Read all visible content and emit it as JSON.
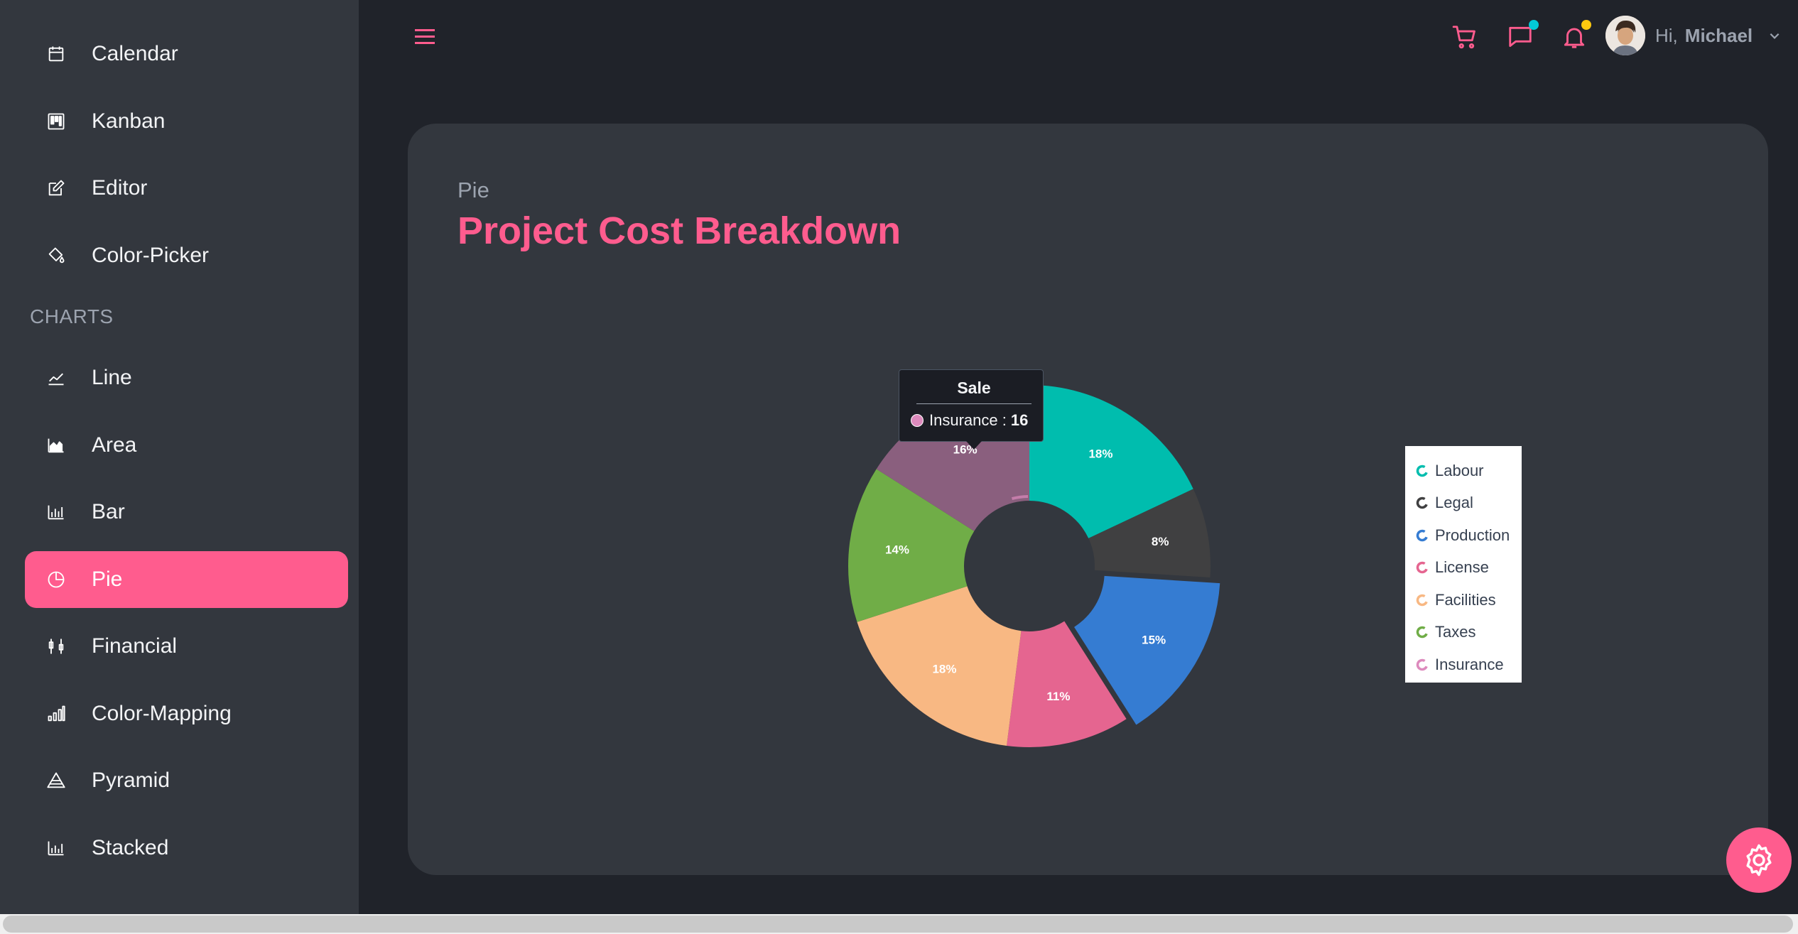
{
  "sidebar": {
    "apps_items": [
      {
        "label": "Calendar",
        "icon": "calendar-icon"
      },
      {
        "label": "Kanban",
        "icon": "kanban-icon"
      },
      {
        "label": "Editor",
        "icon": "editor-icon"
      },
      {
        "label": "Color-Picker",
        "icon": "paint-bucket-icon"
      }
    ],
    "charts_title": "CHARTS",
    "chart_items": [
      {
        "label": "Line",
        "icon": "line-chart-icon"
      },
      {
        "label": "Area",
        "icon": "area-chart-icon"
      },
      {
        "label": "Bar",
        "icon": "bar-chart-icon"
      },
      {
        "label": "Pie",
        "icon": "pie-chart-icon",
        "active": true
      },
      {
        "label": "Financial",
        "icon": "financial-chart-icon"
      },
      {
        "label": "Color-Mapping",
        "icon": "color-mapping-icon"
      },
      {
        "label": "Pyramid",
        "icon": "pyramid-icon"
      },
      {
        "label": "Stacked",
        "icon": "stacked-chart-icon"
      }
    ]
  },
  "header": {
    "greeting": "Hi,",
    "user_name": "Michael",
    "icons": [
      "menu-icon",
      "cart-icon",
      "chat-icon",
      "bell-icon"
    ],
    "chat_dot_color": "#03c9d7",
    "bell_dot_color": "#fec90f"
  },
  "card": {
    "subtitle": "Pie",
    "title": "Project Cost Breakdown"
  },
  "colors": {
    "accent": "#ff5c8e",
    "sidebar_bg": "#33373e",
    "page_bg": "#20232a"
  },
  "chart_data": {
    "type": "pie",
    "donut": true,
    "series": [
      {
        "name": "Sale",
        "values": [
          18,
          8,
          15,
          11,
          18,
          14,
          16
        ]
      }
    ],
    "categories": [
      "Labour",
      "Legal",
      "Production",
      "License",
      "Facilities",
      "Taxes",
      "Insurance"
    ],
    "labels": [
      "18%",
      "8%",
      "15%",
      "11%",
      "18%",
      "14%",
      "16%"
    ],
    "colors": [
      "#00bdae",
      "#404041",
      "#357cd2",
      "#e56590",
      "#f8b883",
      "#70ad47",
      "#dd8abd"
    ],
    "exploded": "Production",
    "highlighted": "Insurance",
    "legend_position": "right",
    "tooltip": {
      "title": "Sale",
      "label": "Insurance :",
      "value": "16"
    }
  }
}
